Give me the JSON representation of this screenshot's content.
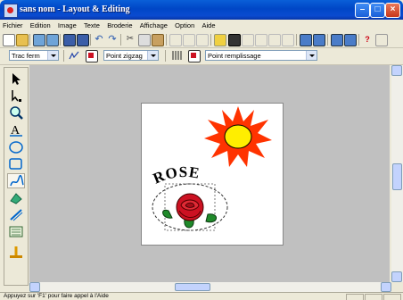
{
  "window": {
    "title": "sans nom - Layout & Editing"
  },
  "menu": [
    "Fichier",
    "Edition",
    "Image",
    "Texte",
    "Broderie",
    "Affichage",
    "Option",
    "Aide"
  ],
  "toolbar2": {
    "line_type": "Trac ferm",
    "line_stitch": "Point zigzag",
    "fill_stitch": "Point remplissage"
  },
  "canvas": {
    "text": "ROSE"
  },
  "status": {
    "text": "Appuyez sur 'F1' pour faire appel à l'Aide"
  },
  "colors": {
    "title_bar": "#0a5fd8",
    "canvas_bg": "#c0c0c0",
    "sun_outer": "#ff3300",
    "sun_inner": "#ffee00",
    "rose": "#cc1122",
    "leaf": "#228822"
  },
  "icons": [
    "new-icon",
    "open-icon",
    "save-icon",
    "undo-icon",
    "redo-icon",
    "cut-icon",
    "copy-icon",
    "paste-icon",
    "select-icon",
    "text-icon",
    "zoom-icon",
    "help-icon"
  ]
}
